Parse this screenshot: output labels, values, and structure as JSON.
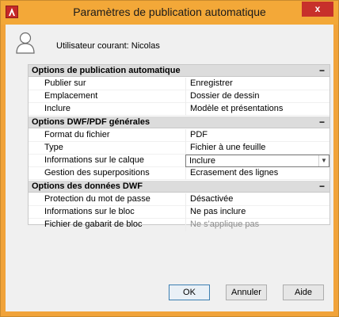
{
  "window": {
    "title": "Paramètres de publication automatique",
    "close_label": "x",
    "accent": "#f3a838"
  },
  "user": {
    "label": "Utilisateur courant: Nicolas"
  },
  "grid": {
    "categories": [
      {
        "title": "Options de publication automatique",
        "collapse": "−",
        "rows": [
          {
            "name": "Publier sur",
            "value": "Enregistrer"
          },
          {
            "name": "Emplacement",
            "value": "Dossier de dessin"
          },
          {
            "name": "Inclure",
            "value": "Modèle et présentations"
          }
        ]
      },
      {
        "title": "Options DWF/PDF générales",
        "collapse": "−",
        "rows": [
          {
            "name": "Format du fichier",
            "value": "PDF"
          },
          {
            "name": "Type",
            "value": "Fichier à une feuille"
          },
          {
            "name": "Informations sur le calque",
            "value": "Inclure"
          },
          {
            "name": "Gestion des superpositions",
            "value": "Ecrasement des lignes"
          }
        ]
      },
      {
        "title": "Options des données DWF",
        "collapse": "−",
        "rows": [
          {
            "name": "Protection du mot de passe",
            "value": "Désactivée"
          },
          {
            "name": "Informations sur le bloc",
            "value": "Ne pas inclure"
          },
          {
            "name": "Fichier de gabarit de bloc",
            "value": "Ne s'applique pas"
          }
        ]
      }
    ]
  },
  "buttons": {
    "ok": "OK",
    "cancel": "Annuler",
    "help": "Aide"
  }
}
